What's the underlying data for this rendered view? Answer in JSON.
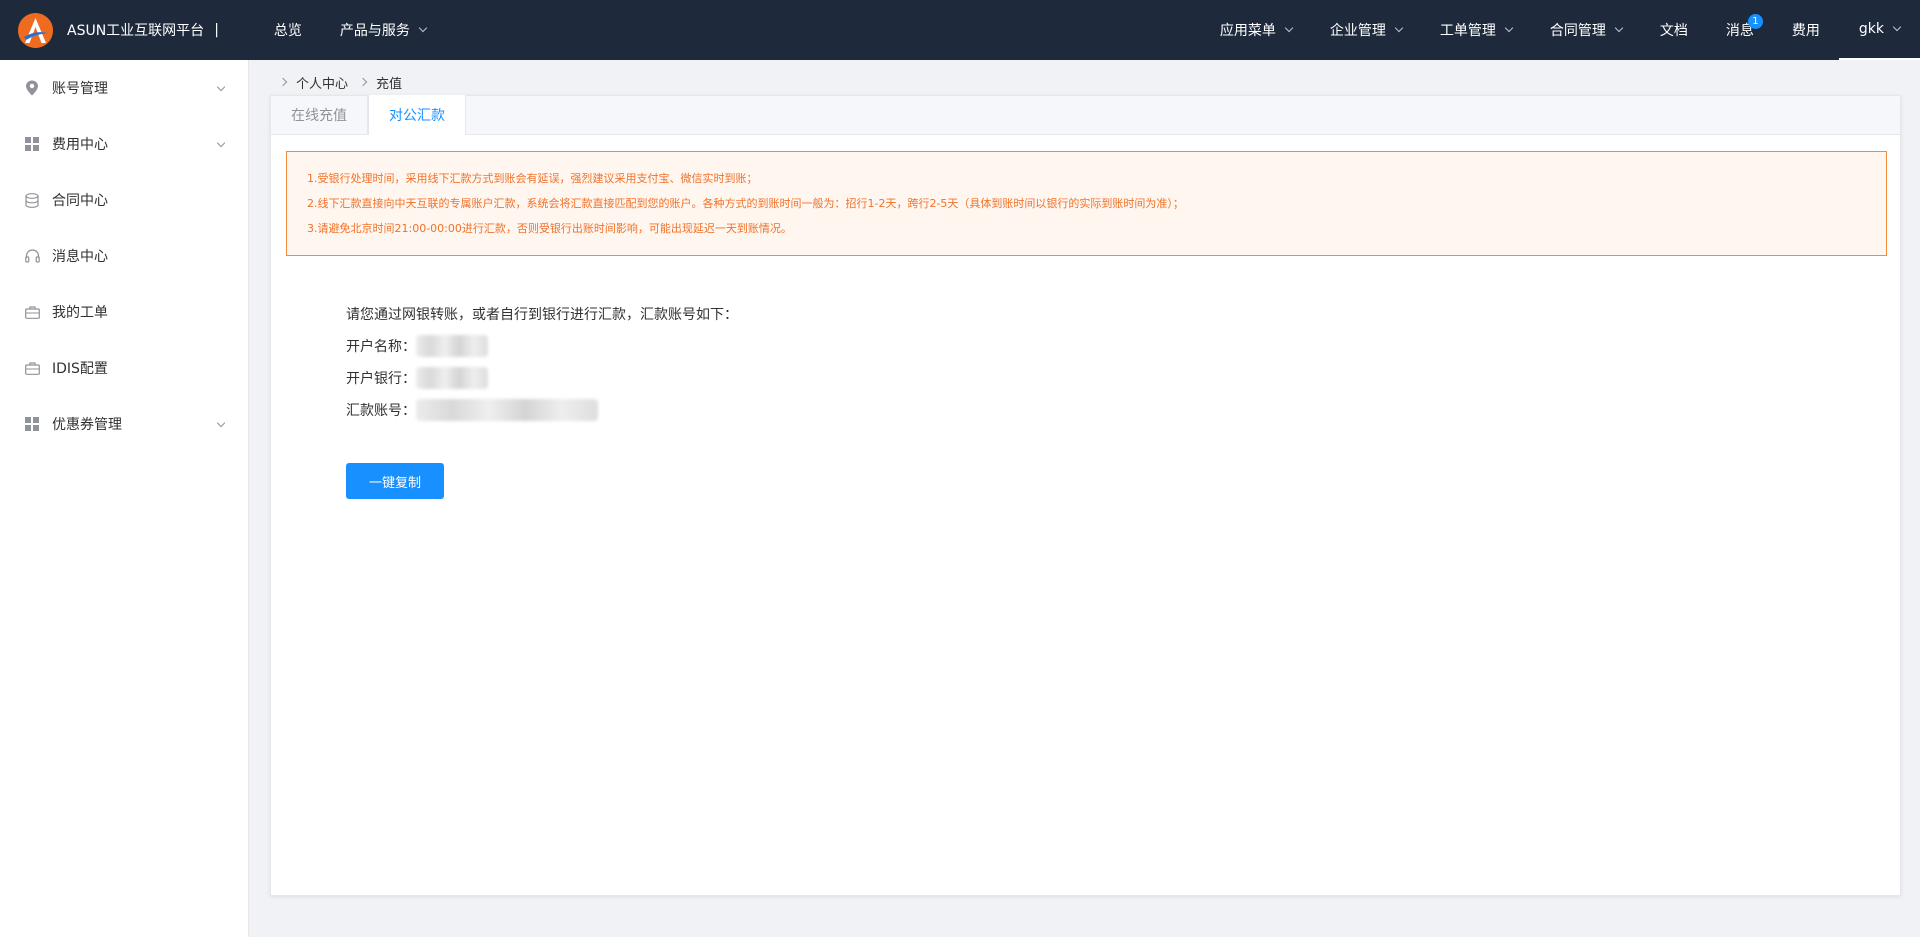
{
  "app": {
    "brand": "ASUN工业互联网平台",
    "brand_sep": "|"
  },
  "topnav": {
    "left": [
      {
        "label": "总览"
      },
      {
        "label": "产品与服务"
      }
    ],
    "right": [
      {
        "label": "应用菜单"
      },
      {
        "label": "企业管理"
      },
      {
        "label": "工单管理"
      },
      {
        "label": "合同管理"
      },
      {
        "label": "文档"
      },
      {
        "label": "消息",
        "badge": "1"
      },
      {
        "label": "费用"
      },
      {
        "label": "gkk"
      }
    ]
  },
  "sidebar": {
    "items": [
      {
        "label": "账号管理",
        "icon": "location-pin-icon"
      },
      {
        "label": "费用中心",
        "icon": "grid-icon"
      },
      {
        "label": "合同中心",
        "icon": "database-icon"
      },
      {
        "label": "消息中心",
        "icon": "headset-icon"
      },
      {
        "label": "我的工单",
        "icon": "briefcase-icon"
      },
      {
        "label": "IDIS配置",
        "icon": "briefcase-icon"
      },
      {
        "label": "优惠券管理",
        "icon": "grid-icon"
      }
    ]
  },
  "breadcrumb": [
    "个人中心",
    "充值"
  ],
  "tabs": [
    {
      "label": "在线充值"
    },
    {
      "label": "对公汇款"
    }
  ],
  "notice": {
    "lines": [
      "1.受银行处理时间，采用线下汇款方式到账会有延误，强烈建议采用支付宝、微信实时到账；",
      "2.线下汇款直接向中天互联的专属账户汇款，系统会将汇款直接匹配到您的账户。各种方式的到账时间一般为：招行1-2天，跨行2-5天（具体到账时间以银行的实际到账时间为准）；",
      "3.请避免北京时间21:00-00:00进行汇款，否则受银行出账时间影响，可能出现延迟一天到账情况。"
    ]
  },
  "info": {
    "intro": "请您通过网银转账，或者自行到银行进行汇款，汇款账号如下：",
    "account_name_label": "开户名称：",
    "bank_label": "开户银行：",
    "account_no_label": "汇款账号："
  },
  "actions": {
    "copy_label": "一键复制"
  },
  "colors": {
    "topbar": "#1e2a3c",
    "accent": "#1890ff",
    "notice_text": "#f0722a",
    "notice_border": "#f08c3c",
    "logo": "#ef6c1f"
  }
}
